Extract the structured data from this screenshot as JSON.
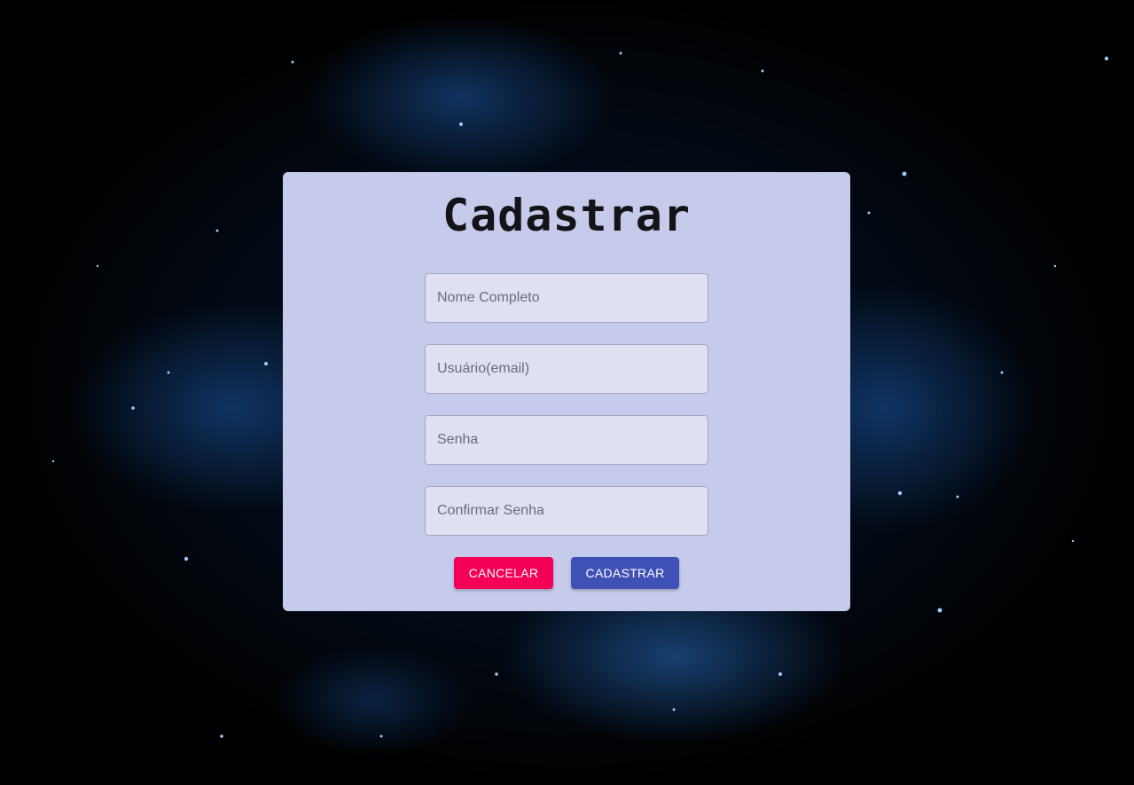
{
  "page": {
    "background": "space-nebula",
    "accent_colors": {
      "card": "#c6cbec",
      "cancel": "#f50057",
      "primary": "#3f51b5"
    }
  },
  "form": {
    "title": "Cadastrar",
    "fields": [
      {
        "name": "full-name-input",
        "placeholder": "Nome Completo",
        "value": ""
      },
      {
        "name": "email-input",
        "placeholder": "Usuário(email)",
        "value": ""
      },
      {
        "name": "password-input",
        "placeholder": "Senha",
        "value": ""
      },
      {
        "name": "confirm-password-input",
        "placeholder": "Confirmar Senha",
        "value": ""
      }
    ],
    "buttons": {
      "cancel_label": "CANCELAR",
      "submit_label": "CADASTRAR"
    }
  }
}
